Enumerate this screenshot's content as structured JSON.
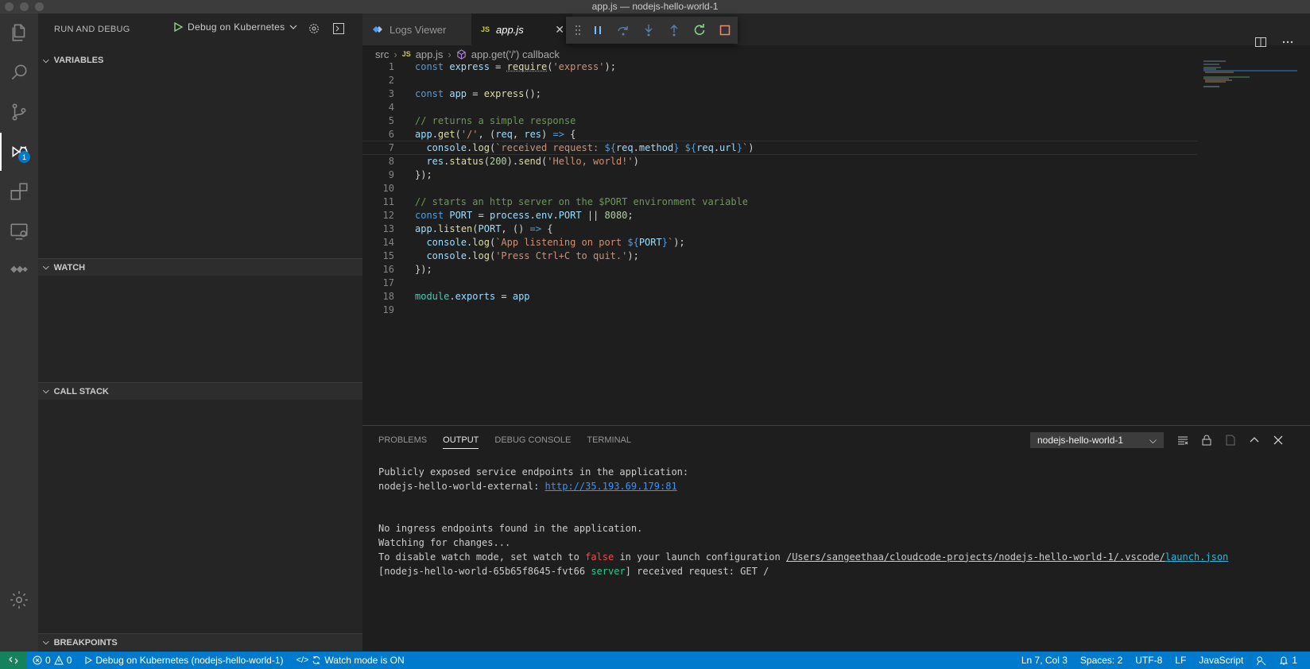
{
  "window": {
    "title": "app.js — nodejs-hello-world-1"
  },
  "activity": {
    "debug_badge": "1"
  },
  "sidebar": {
    "title": "RUN AND DEBUG",
    "config_name": "Debug on Kubernetes",
    "sections": {
      "variables": "VARIABLES",
      "watch": "WATCH",
      "call_stack": "CALL STACK",
      "breakpoints": "BREAKPOINTS"
    }
  },
  "tabs": [
    {
      "label": "Logs Viewer"
    },
    {
      "label": "app.js",
      "icon_text": "JS"
    }
  ],
  "breadcrumb": {
    "folder": "src",
    "file_icon": "JS",
    "file": "app.js",
    "symbol": "app.get('/') callback"
  },
  "editor": {
    "line_numbers": [
      "1",
      "2",
      "3",
      "4",
      "5",
      "6",
      "7",
      "8",
      "9",
      "10",
      "11",
      "12",
      "13",
      "14",
      "15",
      "16",
      "17",
      "18",
      "19"
    ]
  },
  "panel": {
    "tabs": [
      "PROBLEMS",
      "OUTPUT",
      "DEBUG CONSOLE",
      "TERMINAL"
    ],
    "channel": "nodejs-hello-world-1",
    "output": {
      "l1": "Publicly exposed service endpoints in the application:",
      "l2_prefix": "nodejs-hello-world-external: ",
      "l2_link": "http://35.193.69.179:81",
      "l3": "No ingress endpoints found in the application.",
      "l4": "Watching for changes...",
      "l5_a": "To disable watch mode, set watch to ",
      "l5_false": "false",
      "l5_b": " in your launch configuration ",
      "l5_path": "/Users/sangeethaa/cloudcode-projects/nodejs-hello-world-1/.vscode/",
      "l5_file": "launch.json",
      "l6_a": "[nodejs-hello-world-65b65f8645-fvt66 ",
      "l6_server": "server",
      "l6_b": "] received request: GET /"
    }
  },
  "status": {
    "errors": "0",
    "warnings": "0",
    "debug": "Debug on Kubernetes (nodejs-hello-world-1)",
    "watch": "Watch mode is ON",
    "position": "Ln 7, Col 3",
    "spaces": "Spaces: 2",
    "encoding": "UTF-8",
    "eol": "LF",
    "language": "JavaScript",
    "bell": "1"
  },
  "colors": {
    "accent": "#007acc",
    "remote": "#16825d",
    "editor_bg": "#1e1e1e",
    "sidebar_bg": "#252526"
  }
}
